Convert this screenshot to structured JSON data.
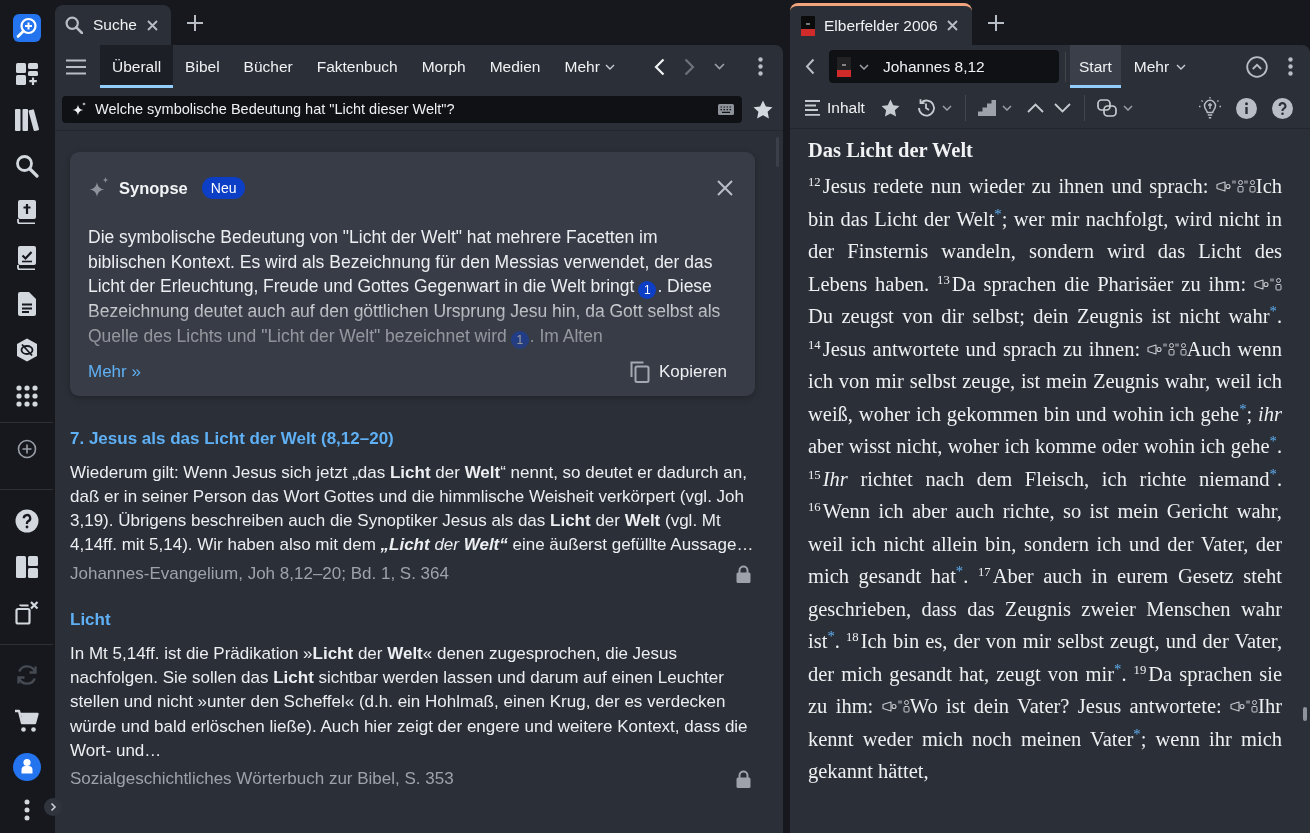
{
  "sidebar": {
    "sync": {
      "disabled": true
    }
  },
  "left_panel": {
    "tab": {
      "label": "Suche"
    },
    "scopes": [
      {
        "label": "Überall",
        "selected": true,
        "kind": "tab"
      },
      {
        "label": "Bibel",
        "selected": false,
        "kind": "tab"
      },
      {
        "label": "Bücher",
        "selected": false,
        "kind": "tab"
      },
      {
        "label": "Faktenbuch",
        "selected": false,
        "kind": "tab"
      },
      {
        "label": "Morph",
        "selected": false,
        "kind": "tab"
      },
      {
        "label": "Medien",
        "selected": false,
        "kind": "tab"
      },
      {
        "label": "Mehr",
        "selected": false,
        "kind": "menu"
      }
    ],
    "history": [
      {
        "kind": "back",
        "disabled": false
      },
      {
        "kind": "forward",
        "disabled": true
      }
    ],
    "query": {
      "value": "Welche symbolische Bedeutung hat \"Licht dieser Welt\"?"
    },
    "synopsis": {
      "title": "Synopse",
      "badge": "Neu",
      "segments": [
        {
          "kind": "text",
          "text": "Die symbolische Bedeutung von \"Licht der Welt\" hat mehrere Facetten im biblischen Kontext. Es wird als Bezeichnung für den Messias verwendet, der das Licht der Erleuchtung, Freude und Gottes Gegenwart in die Welt bringt"
        },
        {
          "kind": "citation",
          "text": "1"
        },
        {
          "kind": "text",
          "text": ". Diese Bezeichnung deutet auch auf den göttlichen Ursprung Jesu hin, da Gott selbst als Quelle des Lichts und \"Licht der Welt\" bezeichnet wird"
        },
        {
          "kind": "citation",
          "text": "1"
        },
        {
          "kind": "text",
          "text": ". Im Alten"
        }
      ],
      "more_link": "Mehr »",
      "copy_button": "Kopieren"
    },
    "results": [
      {
        "title": "7. Jesus als das Licht der Welt (8,12–20)",
        "segments": [
          {
            "kind": "plain",
            "text": "Wiederum gilt: Wenn Jesus sich jetzt „das **Licht** der **Welt**“ nennt, so deutet er dadurch an, daß er in seiner Person das Wort Gottes und die himmlische Weisheit verkörpert (vgl. Joh 3,19). Übrigens beschreiben auch die Synoptiker Jesus als das **Licht** der **Welt** (vgl. Mt 4,14ff. mit 5,14). Wir haben also mit dem "
          },
          {
            "kind": "bold_italic",
            "text": "„Licht"
          },
          {
            "kind": "italic",
            "text": " der "
          },
          {
            "kind": "bold_italic",
            "text": "Welt“"
          },
          {
            "kind": "plain",
            "text": " eine äußerst gefüllte Aussage…"
          }
        ],
        "source": "Johannes-Evangelium, Joh 8,12–20; Bd. 1, S. 364",
        "locked": true
      },
      {
        "title": "Licht",
        "segments": [
          {
            "kind": "plain",
            "text": "In Mt 5,14ff. ist die Prädikation »**Licht** der **Welt**« denen zugesprochen, die Jesus nachfolgen. Sie sollen das **Licht** sichtbar werden lassen und darum auf einen Leuchter stellen und nicht »unter den Scheffel« (d.h. ein Hohlmaß, einen Krug, der es verdecken würde und bald erlöschen ließe). Auch hier zeigt der engere und weitere Kontext, dass die Wort- und…"
          }
        ],
        "source": "Sozialgeschichtliches Wörterbuch zur Bibel, S. 353",
        "locked": true
      }
    ]
  },
  "right_panel": {
    "tab": {
      "label": "Elberfelder 2006"
    },
    "reference": {
      "value": "Johannes 8,12"
    },
    "views": [
      {
        "label": "Start",
        "selected": true,
        "kind": "tab"
      },
      {
        "label": "Mehr",
        "selected": false,
        "kind": "menu"
      }
    ],
    "contents_button": "Inhalt",
    "passage": {
      "heading": "Das Licht der Welt",
      "segments": [
        {
          "kind": "verse",
          "text": "12"
        },
        {
          "kind": "text",
          "text": "Jesus redete nun wieder zu ihnen und sprach: "
        },
        {
          "kind": "speaker"
        },
        {
          "kind": "quote"
        },
        {
          "kind": "quote"
        },
        {
          "kind": "text",
          "text": "Ich bin das Licht der Welt"
        },
        {
          "kind": "footnote",
          "text": "*"
        },
        {
          "kind": "text",
          "text": "; wer mir nachfolgt, wird nicht in der Finsternis wandeln, sondern wird das Licht des Lebens haben. "
        },
        {
          "kind": "verse",
          "text": "13"
        },
        {
          "kind": "text",
          "text": "Da sprachen die Pharisäer zu ihm: "
        },
        {
          "kind": "speaker"
        },
        {
          "kind": "quote"
        },
        {
          "kind": "text",
          "text": "Du zeugst von dir selbst; dein Zeugnis ist nicht wahr"
        },
        {
          "kind": "footnote",
          "text": "*"
        },
        {
          "kind": "text",
          "text": ". "
        },
        {
          "kind": "verse",
          "text": "14"
        },
        {
          "kind": "text",
          "text": "Jesus antwortete und sprach zu ihnen: "
        },
        {
          "kind": "speaker"
        },
        {
          "kind": "quote"
        },
        {
          "kind": "quote"
        },
        {
          "kind": "text",
          "text": "Auch wenn ich von mir selbst zeuge, ist mein Zeugnis wahr, weil ich weiß, woher ich gekommen bin und wohin ich gehe"
        },
        {
          "kind": "footnote",
          "text": "*"
        },
        {
          "kind": "text",
          "text": "; *ihr* aber wisst nicht, woher ich komme oder wohin ich gehe"
        },
        {
          "kind": "footnote",
          "text": "*"
        },
        {
          "kind": "text",
          "text": ". "
        },
        {
          "kind": "verse",
          "text": "15"
        },
        {
          "kind": "text",
          "text": "*Ihr* richtet nach dem Fleisch, ich richte niemand"
        },
        {
          "kind": "footnote",
          "text": "*"
        },
        {
          "kind": "text",
          "text": ". "
        },
        {
          "kind": "verse",
          "text": "16"
        },
        {
          "kind": "text",
          "text": "Wenn ich aber auch richte, so ist mein Gericht wahr, weil ich nicht allein bin, sondern ich und der Vater, der mich gesandt hat"
        },
        {
          "kind": "footnote",
          "text": "*"
        },
        {
          "kind": "text",
          "text": ". "
        },
        {
          "kind": "verse",
          "text": "17"
        },
        {
          "kind": "text",
          "text": "Aber auch in eurem Gesetz steht geschrieben, dass das Zeugnis zweier Menschen wahr ist"
        },
        {
          "kind": "footnote",
          "text": "*"
        },
        {
          "kind": "text",
          "text": ". "
        },
        {
          "kind": "verse",
          "text": "18"
        },
        {
          "kind": "text",
          "text": "Ich bin es, der von mir selbst zeugt, und der Vater, der mich gesandt hat, zeugt von mir"
        },
        {
          "kind": "footnote",
          "text": "*"
        },
        {
          "kind": "text",
          "text": ". "
        },
        {
          "kind": "verse",
          "text": "19"
        },
        {
          "kind": "text",
          "text": "Da sprachen sie zu ihm: "
        },
        {
          "kind": "speaker"
        },
        {
          "kind": "quote"
        },
        {
          "kind": "text",
          "text": "Wo ist dein Vater? Jesus antwortete: "
        },
        {
          "kind": "speaker"
        },
        {
          "kind": "quote"
        },
        {
          "kind": "text",
          "text": "Ihr kennt weder mich noch meinen Vater"
        },
        {
          "kind": "footnote",
          "text": "*"
        },
        {
          "kind": "text",
          "text": "; wenn ihr mich gekannt hättet,"
        }
      ]
    }
  }
}
